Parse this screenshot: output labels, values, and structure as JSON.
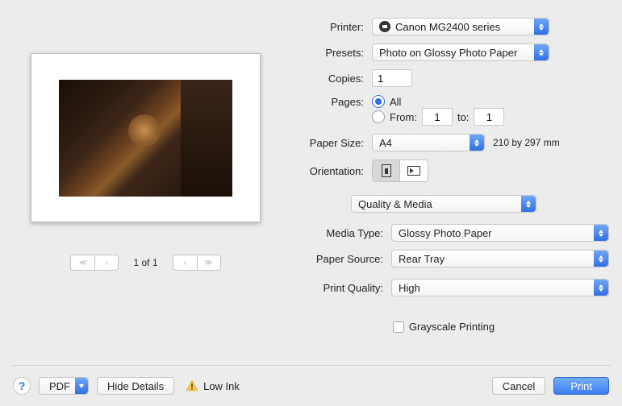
{
  "labels": {
    "printer": "Printer:",
    "presets": "Presets:",
    "copies": "Copies:",
    "pages": "Pages:",
    "all": "All",
    "from": "From:",
    "to": "to:",
    "paper_size": "Paper Size:",
    "orientation": "Orientation:",
    "media_type": "Media Type:",
    "paper_source": "Paper Source:",
    "print_quality": "Print Quality:",
    "grayscale": "Grayscale Printing"
  },
  "printer": {
    "value": "Canon MG2400 series"
  },
  "presets": {
    "value": "Photo on Glossy Photo Paper"
  },
  "copies": {
    "value": "1"
  },
  "pages": {
    "all_selected": true,
    "from": "1",
    "to": "1"
  },
  "paper_size": {
    "value": "A4",
    "note": "210 by 297 mm"
  },
  "section": {
    "value": "Quality & Media"
  },
  "media_type": {
    "value": "Glossy Photo Paper"
  },
  "paper_source": {
    "value": "Rear Tray"
  },
  "print_quality": {
    "value": "High"
  },
  "grayscale": {
    "checked": false
  },
  "pager": {
    "label": "1 of 1"
  },
  "footer": {
    "pdf": "PDF",
    "hide_details": "Hide Details",
    "low_ink": "Low Ink",
    "cancel": "Cancel",
    "print": "Print"
  }
}
